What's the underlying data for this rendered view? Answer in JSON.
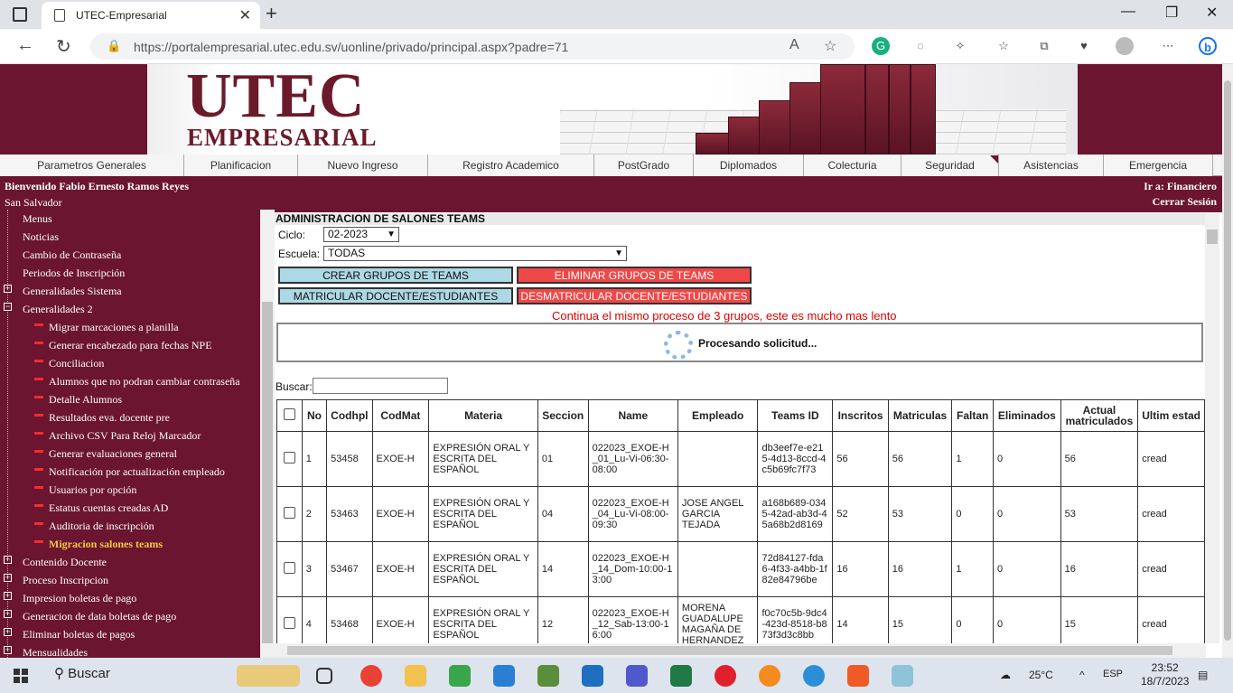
{
  "browser": {
    "tab_title": "UTEC-Empresarial",
    "url": "https://portalempresarial.utec.edu.sv/uonline/privado/principal.aspx?padre=71"
  },
  "header": {
    "logo_main": "UTEC",
    "logo_sub": "EMPRESARIAL"
  },
  "menu": [
    "Parametros Generales",
    "Planificacion",
    "Nuevo Ingreso",
    "Registro Academico",
    "PostGrado",
    "Diplomados",
    "Colecturia",
    "Seguridad",
    "Asistencias",
    "Emergencia"
  ],
  "welcome": {
    "name": "Bienvenido Fabio Ernesto Ramos Reyes",
    "city": "San Salvador",
    "ir_a": "Ir a: Financiero",
    "logout": "Cerrar Sesión"
  },
  "sidebar": {
    "top_items": [
      "Menus",
      "Noticias",
      "Cambio de Contraseña",
      "Periodos de Inscripción",
      "Generalidades Sistema",
      "Generalidades 2"
    ],
    "sub_items": [
      "Migrar marcaciones a planilla",
      "Generar encabezado para fechas NPE",
      "Conciliacion",
      "Alumnos que no podran cambiar contraseña",
      "Detalle Alumnos",
      "Resultados eva. docente pre",
      "Archivo CSV Para Reloj Marcador",
      "Generar evaluaciones general",
      "Notificación por actualización empleado",
      "Usuarios por opción",
      "Estatus cuentas creadas AD",
      "Auditoria de inscripción",
      "Migracion salones teams"
    ],
    "bottom_items": [
      "Contenido Docente",
      "Proceso Inscripcion",
      "Impresion boletas de pago",
      "Generacion de data boletas de pago",
      "Eliminar boletas de pagos",
      "Mensualidades"
    ]
  },
  "panel": {
    "title": "ADMINISTRACION DE SALONES TEAMS",
    "ciclo_label": "Ciclo:",
    "ciclo_value": "02-2023",
    "escuela_label": "Escuela:",
    "escuela_value": "TODAS",
    "btn_crear": "CREAR GRUPOS DE TEAMS",
    "btn_eliminar": "ELIMINAR GRUPOS DE TEAMS",
    "btn_matricular": "MATRICULAR DOCENTE/ESTUDIANTES",
    "btn_desmatricular": "DESMATRICULAR DOCENTE/ESTUDIANTES",
    "warning": "Continua el mismo proceso de 3 grupos, este es mucho mas lento",
    "processing": "Procesando solicitud...",
    "search_label": "Buscar:"
  },
  "table": {
    "headers": [
      "No",
      "Codhpl",
      "CodMat",
      "Materia",
      "Seccion",
      "Name",
      "Empleado",
      "Teams ID",
      "Inscritos",
      "Matriculas",
      "Faltan",
      "Eliminados",
      "Actual matriculados",
      "Ultim estad"
    ],
    "rows": [
      [
        "1",
        "53458",
        "EXOE-H",
        "EXPRESIÓN ORAL Y ESCRITA DEL ESPAÑOL",
        "01",
        "022023_EXOE-H_01_Lu-Vi-06:30-08:00",
        "",
        "db3eef7e-e215-4d13-8ccd-4c5b69fc7f73",
        "56",
        "56",
        "1",
        "0",
        "56",
        "cread"
      ],
      [
        "2",
        "53463",
        "EXOE-H",
        "EXPRESIÓN ORAL Y ESCRITA DEL ESPAÑOL",
        "04",
        "022023_EXOE-H_04_Lu-Vi-08:00-09:30",
        "JOSE ANGEL GARCIA TEJADA",
        "a168b689-0345-42ad-ab3d-45a68b2d8169",
        "52",
        "53",
        "0",
        "0",
        "53",
        "cread"
      ],
      [
        "3",
        "53467",
        "EXOE-H",
        "EXPRESIÓN ORAL Y ESCRITA DEL ESPAÑOL",
        "14",
        "022023_EXOE-H_14_Dom-10:00-13:00",
        "",
        "72d84127-fda6-4f33-a4bb-1f82e84796be",
        "16",
        "16",
        "1",
        "0",
        "16",
        "cread"
      ],
      [
        "4",
        "53468",
        "EXOE-H",
        "EXPRESIÓN ORAL Y ESCRITA DEL ESPAÑOL",
        "12",
        "022023_EXOE-H_12_Sab-13:00-16:00",
        "MORENA GUADALUPE MAGAÑA DE HERNANDEZ",
        "f0c70c5b-9dc4-423d-8518-b873f3d3c8bb",
        "14",
        "15",
        "0",
        "0",
        "15",
        "cread"
      ]
    ]
  },
  "taskbar": {
    "search": "Buscar",
    "temp": "25°C",
    "lang": "ESP",
    "time": "23:52",
    "date": "18/7/2023"
  }
}
